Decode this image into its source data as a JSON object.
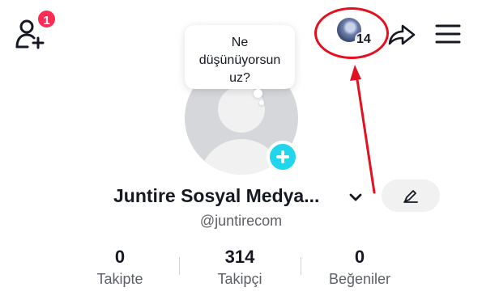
{
  "header": {
    "add_friend_icon": "person-plus-icon",
    "notification_count": "1",
    "viewer_count": "14",
    "share_icon": "share-arrow-icon",
    "menu_icon": "hamburger-menu-icon"
  },
  "bubble": {
    "lines": [
      "Ne",
      "düşünüyorsun",
      "uz?"
    ]
  },
  "profile": {
    "display_name": "Juntire Sosyal Medya...",
    "username": "@juntirecom",
    "avatar_icon": "default-avatar-icon",
    "add_avatar_icon": "plus-icon",
    "edit_icon": "pencil-icon"
  },
  "stats": [
    {
      "value": "0",
      "label": "Takipte"
    },
    {
      "value": "314",
      "label": "Takipçi"
    },
    {
      "value": "0",
      "label": "Beğeniler"
    }
  ],
  "colors": {
    "badge": "#fe2c55",
    "accent_cyan": "#20d5ec",
    "annotation_red": "#e4101f",
    "text_primary": "#161823",
    "text_secondary": "#5e6068"
  }
}
